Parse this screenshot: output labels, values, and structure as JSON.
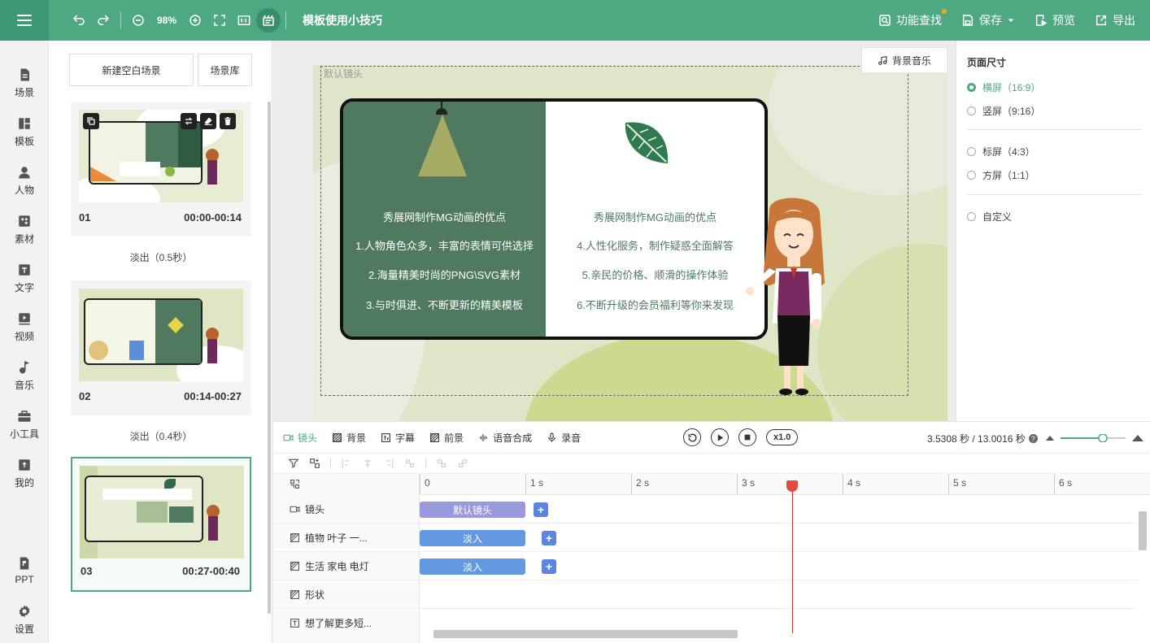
{
  "topbar": {
    "zoom": "98%",
    "title": "模板使用小技巧",
    "actions": {
      "find": "功能查找",
      "save": "保存",
      "preview": "预览",
      "export": "导出"
    }
  },
  "nav": [
    {
      "label": "场景",
      "icon": "scene-icon"
    },
    {
      "label": "模板",
      "icon": "template-icon"
    },
    {
      "label": "人物",
      "icon": "person-icon"
    },
    {
      "label": "素材",
      "icon": "material-icon"
    },
    {
      "label": "文字",
      "icon": "text-icon"
    },
    {
      "label": "视频",
      "icon": "video-icon"
    },
    {
      "label": "音乐",
      "icon": "music-icon"
    },
    {
      "label": "小工具",
      "icon": "toolbox-icon"
    },
    {
      "label": "我的",
      "icon": "upload-icon"
    },
    {
      "label": "PPT",
      "icon": "ppt-icon"
    },
    {
      "label": "设置",
      "icon": "settings-icon"
    }
  ],
  "scenes": {
    "new_blank": "新建空白场景",
    "library": "场景库",
    "items": [
      {
        "num": "01",
        "time": "00:00-00:14",
        "transition": "淡出（0.5秒）"
      },
      {
        "num": "02",
        "time": "00:14-00:27",
        "transition": "淡出（0.4秒）"
      },
      {
        "num": "03",
        "time": "00:27-00:40"
      }
    ]
  },
  "canvas": {
    "bgm": "背景音乐",
    "camera_label": "默认镜头",
    "left_title": "秀展网制作MG动画的优点",
    "left_lines": [
      "1.人物角色众多，丰富的表情可供选择",
      "2.海量精美时尚的PNG\\SVG素材",
      "3.与时俱进、不断更新的精美模板"
    ],
    "right_title": "秀展网制作MG动画的优点",
    "right_lines": [
      "4.人性化服务，制作疑惑全面解答",
      "5.亲民的价格、顺滑的操作体验",
      "6.不断升级的会员福利等你来发现"
    ]
  },
  "page_size": {
    "title": "页面尺寸",
    "options": [
      {
        "label": "横屏（16:9）",
        "selected": true
      },
      {
        "label": "竖屏（9:16）",
        "selected": false
      },
      {
        "label": "标屏（4:3）",
        "selected": false
      },
      {
        "label": "方屏（1:1）",
        "selected": false
      },
      {
        "label": "自定义",
        "selected": false
      }
    ]
  },
  "timeline": {
    "tabs": [
      "镜头",
      "背景",
      "字幕",
      "前景",
      "语音合成",
      "录音"
    ],
    "speed": "x1.0",
    "time_display": "3.5308 秒 / 13.0016 秒",
    "ruler": [
      "0",
      "1 s",
      "2 s",
      "3 s",
      "4 s",
      "5 s",
      "6 s"
    ],
    "tracks": [
      {
        "label": "镜头",
        "clip": "默认镜头"
      },
      {
        "label": "植物 叶子 一...",
        "clip": "淡入"
      },
      {
        "label": "生活 家电 电灯",
        "clip": "淡入"
      },
      {
        "label": "形状",
        "clip": ""
      },
      {
        "label": "想了解更多短...",
        "clip": ""
      }
    ],
    "playhead_seconds": 3.5308
  },
  "colors": {
    "brand": "#4ea983",
    "board": "#4f7a60",
    "clip_camera": "#9a99dc",
    "clip_anim": "#6399e0",
    "playhead": "#d0342c"
  }
}
